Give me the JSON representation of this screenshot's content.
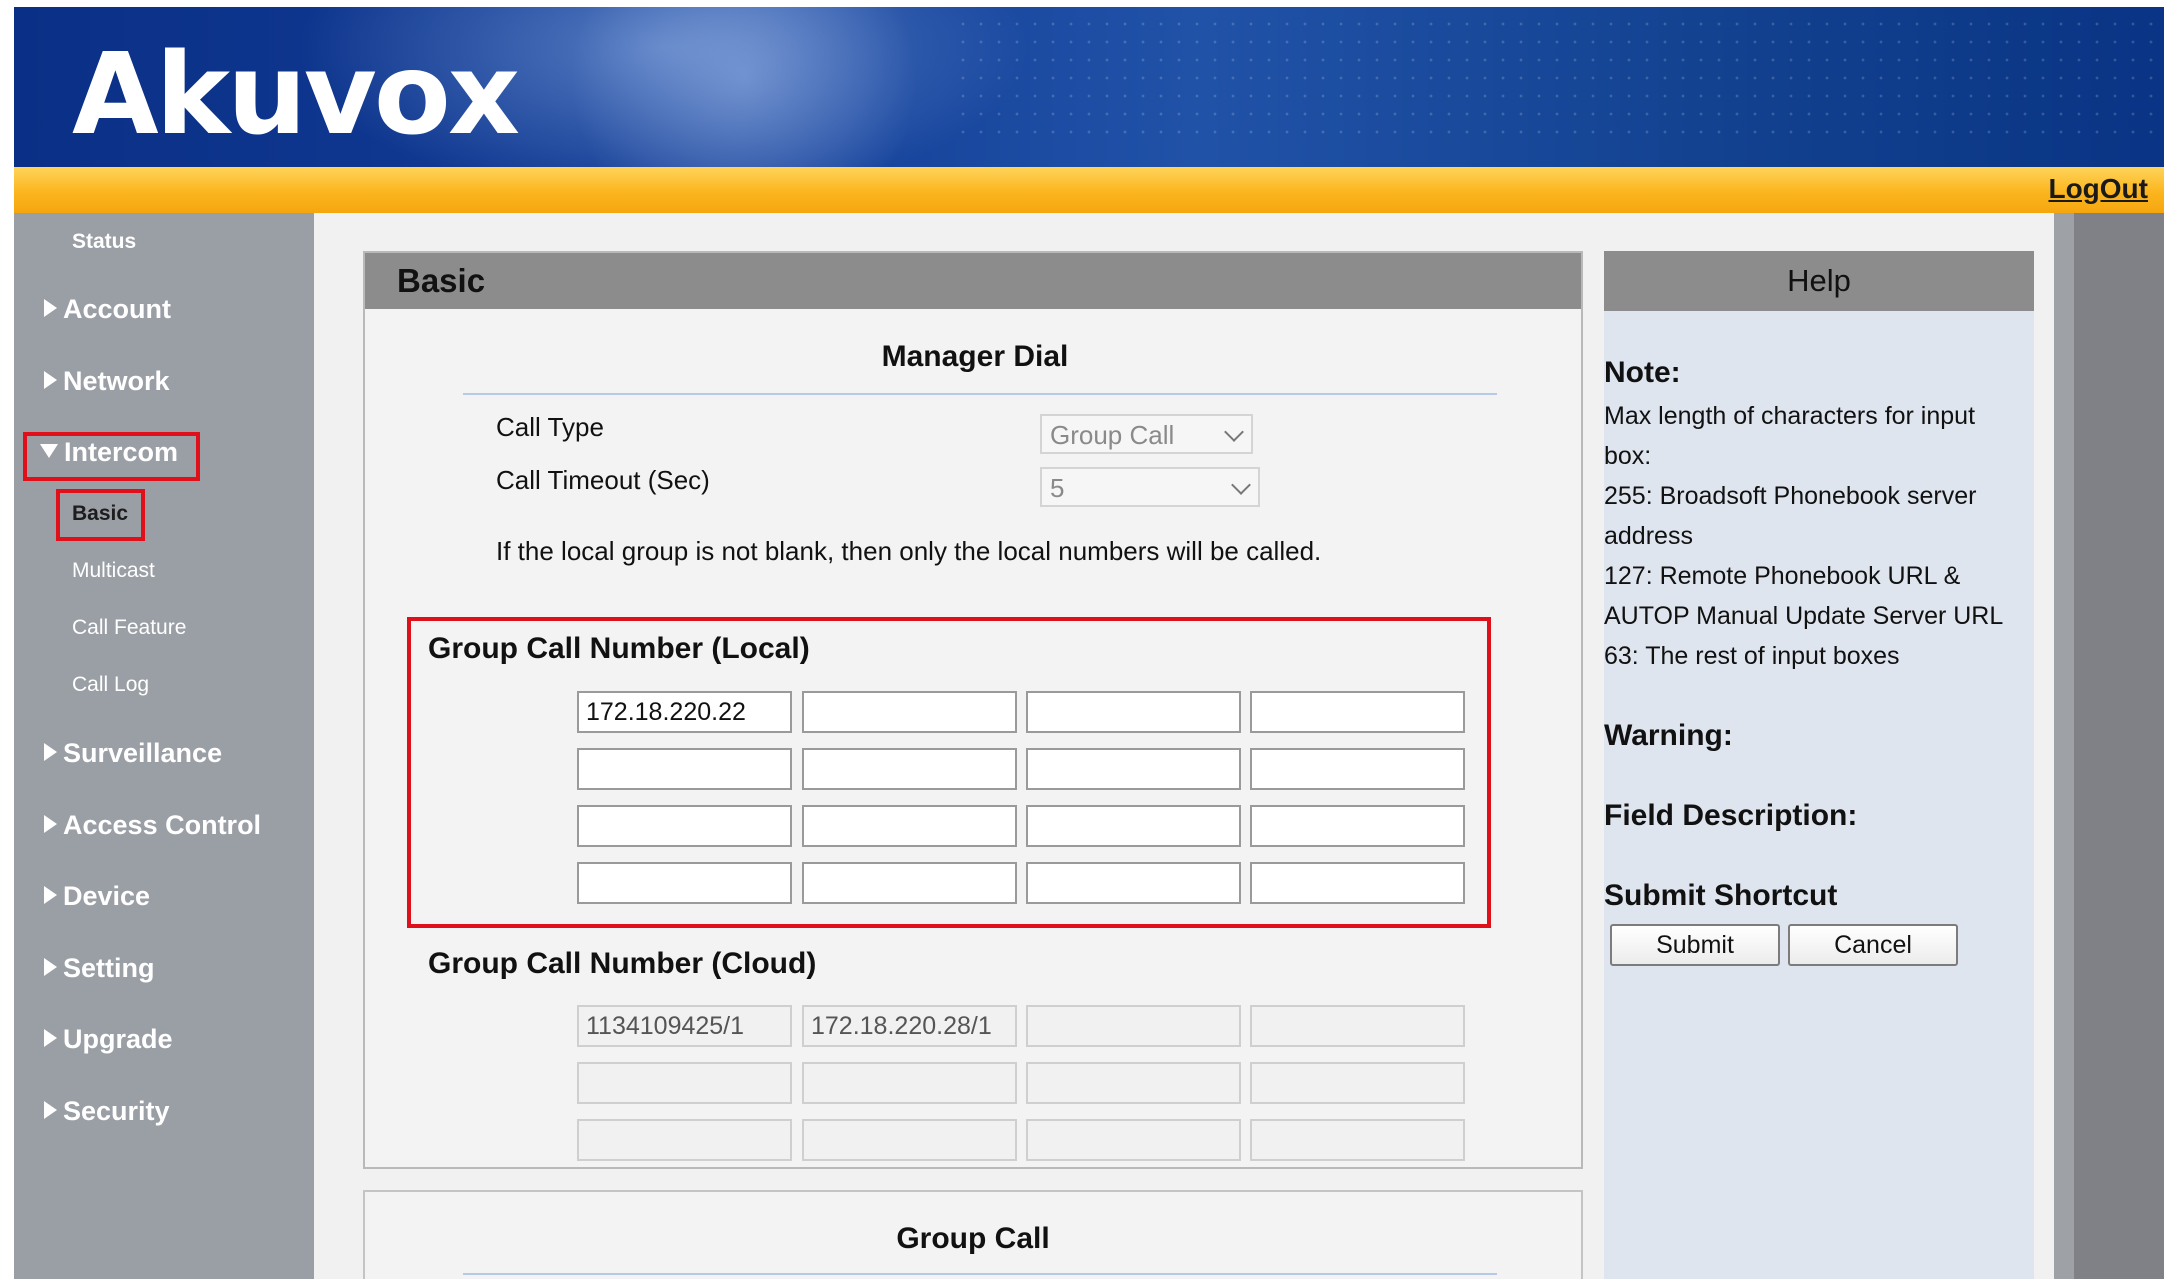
{
  "header": {
    "logo": "Akuvox",
    "logout": "LogOut"
  },
  "sidebar": {
    "status": "Status",
    "items": [
      {
        "label": "Account"
      },
      {
        "label": "Network"
      },
      {
        "label": "Intercom"
      },
      {
        "label": "Surveillance"
      },
      {
        "label": "Access Control"
      },
      {
        "label": "Device"
      },
      {
        "label": "Setting"
      },
      {
        "label": "Upgrade"
      },
      {
        "label": "Security"
      }
    ],
    "intercom_sub": [
      "Basic",
      "Multicast",
      "Call Feature",
      "Call Log"
    ]
  },
  "panel": {
    "title": "Basic",
    "manager_dial": {
      "title": "Manager Dial",
      "call_type_label": "Call Type",
      "call_type_value": "Group Call",
      "call_timeout_label": "Call Timeout (Sec)",
      "call_timeout_value": "5",
      "note": "If the local group is not blank, then only the local numbers will be called."
    },
    "local": {
      "title": "Group Call Number (Local)",
      "values": [
        "172.18.220.22",
        "",
        "",
        "",
        "",
        "",
        "",
        "",
        "",
        "",
        "",
        "",
        "",
        "",
        "",
        ""
      ]
    },
    "cloud": {
      "title": "Group Call Number (Cloud)",
      "values": [
        "1134109425/1",
        "172.18.220.28/1",
        "",
        "",
        "",
        "",
        "",
        "",
        "",
        "",
        "",
        ""
      ]
    },
    "group_call_title": "Group Call"
  },
  "help": {
    "title": "Help",
    "note_heading": "Note:",
    "note_lines": [
      "Max length of characters for input",
      "box:",
      "255: Broadsoft Phonebook server",
      "address",
      "127: Remote Phonebook URL &",
      "AUTOP Manual Update Server URL",
      "63: The rest of input boxes"
    ],
    "warning_heading": "Warning:",
    "field_heading": "Field Description:",
    "shortcut_heading": "Submit Shortcut",
    "submit": "Submit",
    "cancel": "Cancel"
  }
}
